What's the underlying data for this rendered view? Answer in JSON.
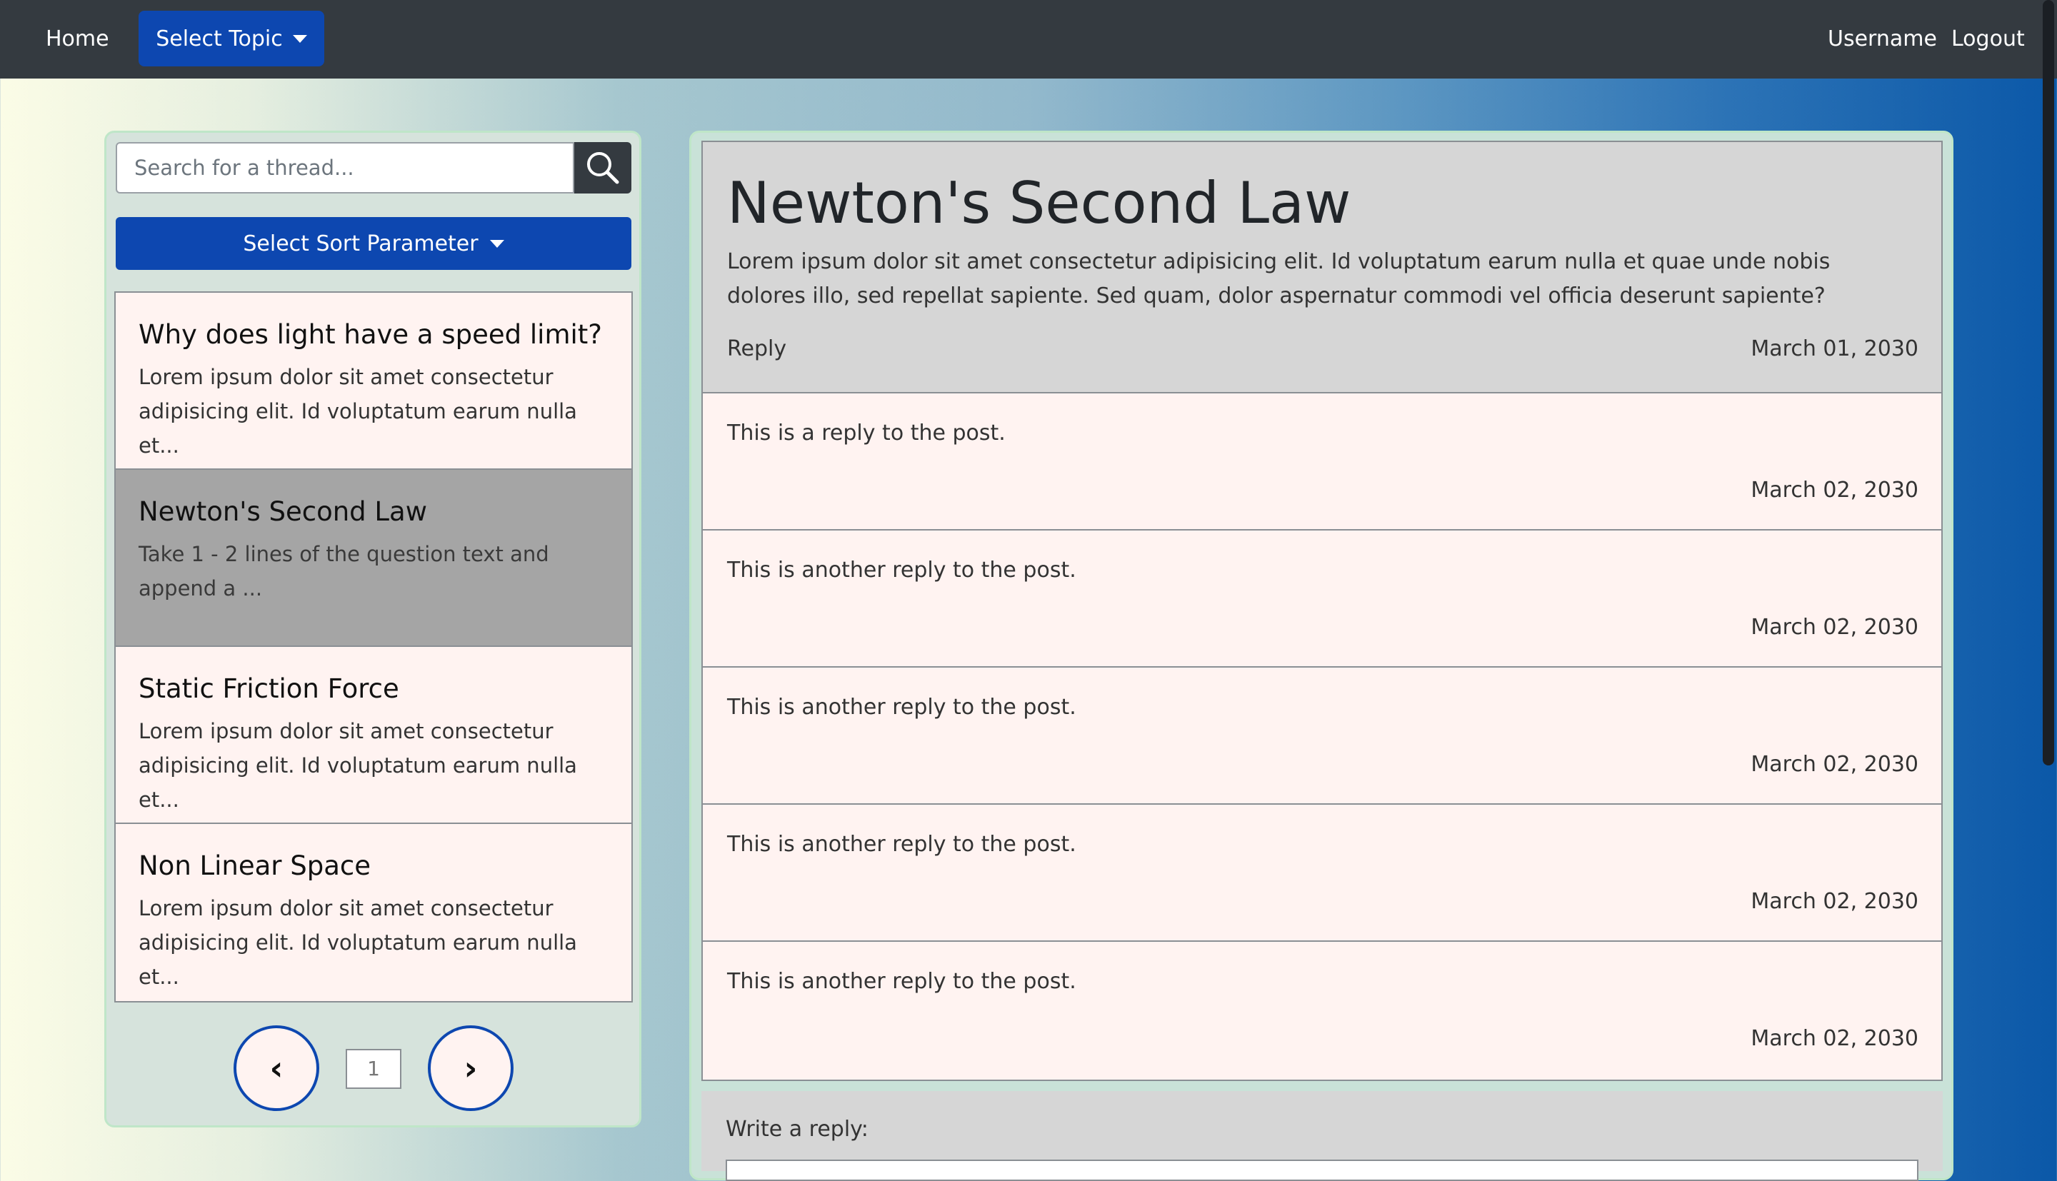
{
  "navbar": {
    "home_label": "Home",
    "topic_label": "Select Topic",
    "username_label": "Username",
    "logout_label": "Logout"
  },
  "sidebar": {
    "search_placeholder": "Search for a thread...",
    "sort_label": "Select Sort Parameter",
    "threads": [
      {
        "title": "Why does light have a speed limit?",
        "snippet": "Lorem ipsum dolor sit amet consectetur adipisicing elit. Id voluptatum earum nulla et..."
      },
      {
        "title": "Newton's Second Law",
        "snippet": "Take 1 - 2 lines of the question text and append a ..."
      },
      {
        "title": "Static Friction Force",
        "snippet": "Lorem ipsum dolor sit amet consectetur adipisicing elit. Id voluptatum earum nulla et..."
      },
      {
        "title": "Non Linear Space",
        "snippet": "Lorem ipsum dolor sit amet consectetur adipisicing elit. Id voluptatum earum nulla et..."
      }
    ],
    "pagination": {
      "prev": "‹",
      "page": "1",
      "next": "›"
    }
  },
  "post": {
    "title": "Newton's Second Law",
    "body": "Lorem ipsum dolor sit amet consectetur adipisicing elit. Id voluptatum earum nulla et quae unde nobis dolores illo, sed repellat sapiente. Sed quam, dolor aspernatur commodi vel officia deserunt sapiente?",
    "reply_label": "Reply",
    "date": "March 01, 2030",
    "replies": [
      {
        "text": "This is a reply to the post.",
        "date": "March 02, 2030"
      },
      {
        "text": "This is another reply to the post.",
        "date": "March 02, 2030"
      },
      {
        "text": "This is another reply to the post.",
        "date": "March 02, 2030"
      },
      {
        "text": "This is another reply to the post.",
        "date": "March 02, 2030"
      },
      {
        "text": "This is another reply to the post.",
        "date": "March 02, 2030"
      }
    ]
  },
  "write": {
    "label": "Write a reply:"
  }
}
